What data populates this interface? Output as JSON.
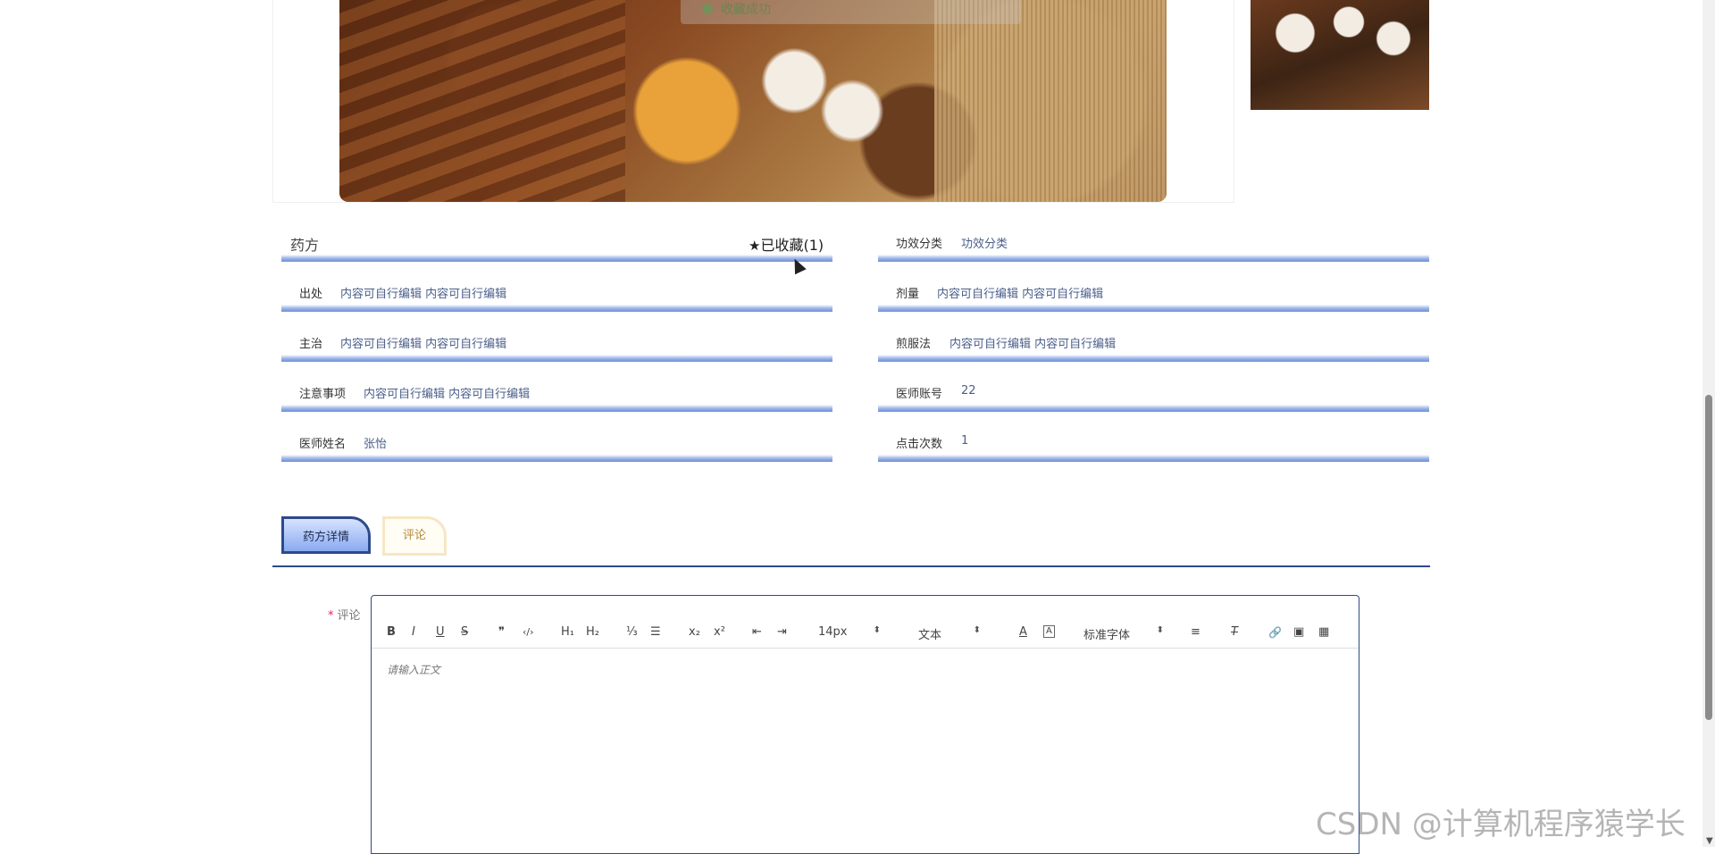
{
  "toast": {
    "text": "收藏成功"
  },
  "recipe": {
    "title": "药方",
    "favorite_label": "已收藏(1)",
    "left_rows": [
      {
        "label": "出处",
        "value": "内容可自行编辑 内容可自行编辑"
      },
      {
        "label": "主治",
        "value": "内容可自行编辑 内容可自行编辑"
      },
      {
        "label": "注意事项",
        "value": "内容可自行编辑 内容可自行编辑"
      },
      {
        "label": "医师姓名",
        "value": "张怡"
      }
    ],
    "right_rows": [
      {
        "label": "功效分类",
        "value": "功效分类"
      },
      {
        "label": "剂量",
        "value": "内容可自行编辑 内容可自行编辑"
      },
      {
        "label": "煎服法",
        "value": "内容可自行编辑 内容可自行编辑"
      },
      {
        "label": "医师账号",
        "value": "22"
      },
      {
        "label": "点击次数",
        "value": "1"
      }
    ]
  },
  "tabs": [
    {
      "label": "药方详情",
      "active": true
    },
    {
      "label": "评论",
      "active": false
    }
  ],
  "comment": {
    "required_mark": "*",
    "label": "评论",
    "placeholder": "请输入正文",
    "toolbar": {
      "bold": "B",
      "italic": "I",
      "underline": "U",
      "strike": "S",
      "quote": "❞",
      "code": "‹/›",
      "h1": "H₁",
      "h2": "H₂",
      "ordered_list": "⅓",
      "bullet_list": "☰",
      "subscript": "x₂",
      "superscript": "x²",
      "outdent": "⇤",
      "indent": "⇥",
      "font_size": "14px",
      "block_type": "文本",
      "font_color": "A",
      "font_bg": "A",
      "font_family": "标准字体",
      "align": "≡",
      "clear": "T",
      "link": "🔗",
      "image": "▣",
      "video": "▦"
    }
  },
  "watermark": {
    "text": "CSDN @计算机程序猿学长"
  }
}
